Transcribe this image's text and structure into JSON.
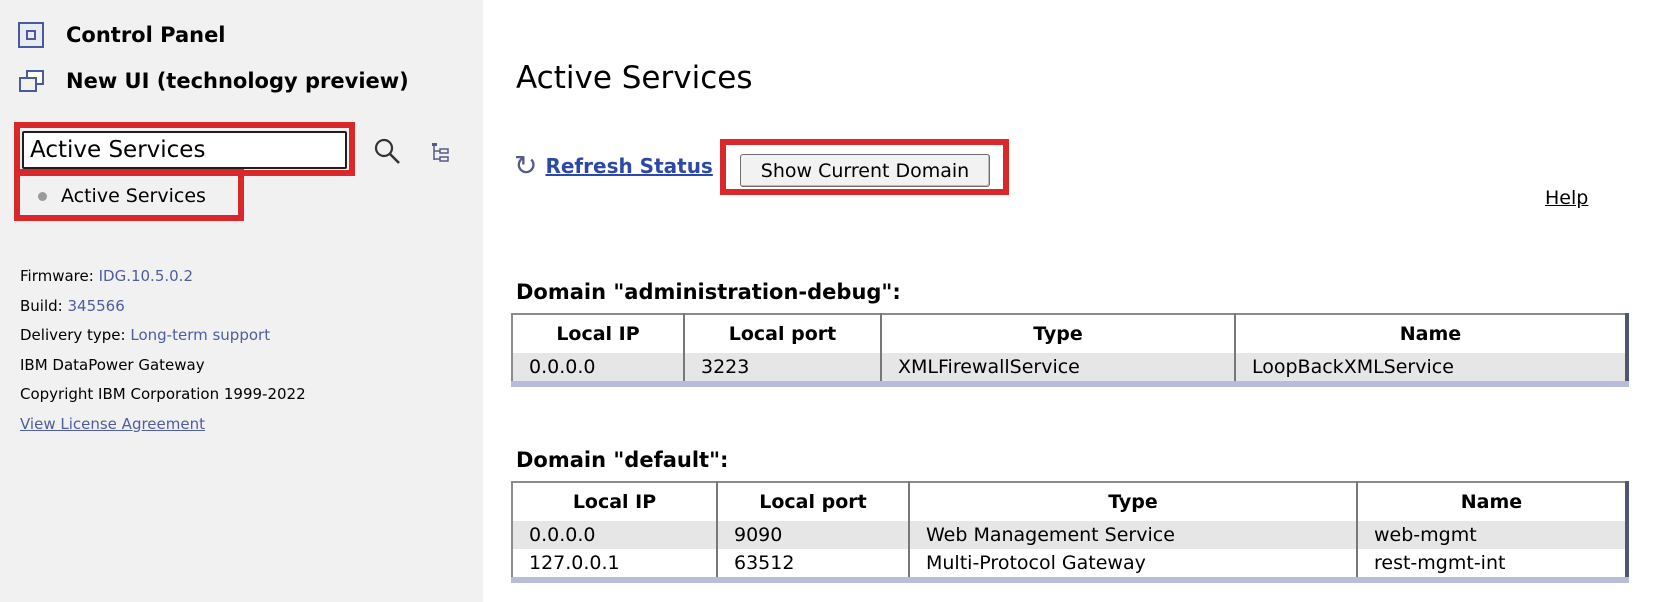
{
  "sidebar": {
    "control_panel": "Control Panel",
    "new_ui": "New UI (technology preview)",
    "search": {
      "value": "Active Services"
    },
    "result": "Active Services",
    "info": {
      "firmware_label": "Firmware:",
      "firmware_value": "IDG.10.5.0.2",
      "build_label": "Build:",
      "build_value": "345566",
      "delivery_label": "Delivery type:",
      "delivery_value": "Long-term support",
      "product": "IBM DataPower Gateway",
      "copyright": "Copyright IBM Corporation 1999-2022",
      "license_link": "View License Agreement"
    }
  },
  "main": {
    "title": "Active Services",
    "refresh_label": "Refresh Status",
    "show_domain_label": "Show Current Domain",
    "help_label": "Help",
    "columns": [
      "Local IP",
      "Local port",
      "Type",
      "Name"
    ],
    "domains": [
      {
        "title": "Domain \"administration-debug\":",
        "rows": [
          [
            "0.0.0.0",
            "3223",
            "XMLFirewallService",
            "LoopBackXMLService"
          ]
        ]
      },
      {
        "title": "Domain \"default\":",
        "rows": [
          [
            "0.0.0.0",
            "9090",
            "Web Management Service",
            "web-mgmt"
          ],
          [
            "127.0.0.1",
            "63512",
            "Multi-Protocol Gateway",
            "rest-mgmt-int"
          ]
        ]
      }
    ]
  },
  "colors": {
    "highlight": "#d9282b",
    "link": "#2c49a8",
    "sidebar_bg": "#f1f1f1"
  }
}
